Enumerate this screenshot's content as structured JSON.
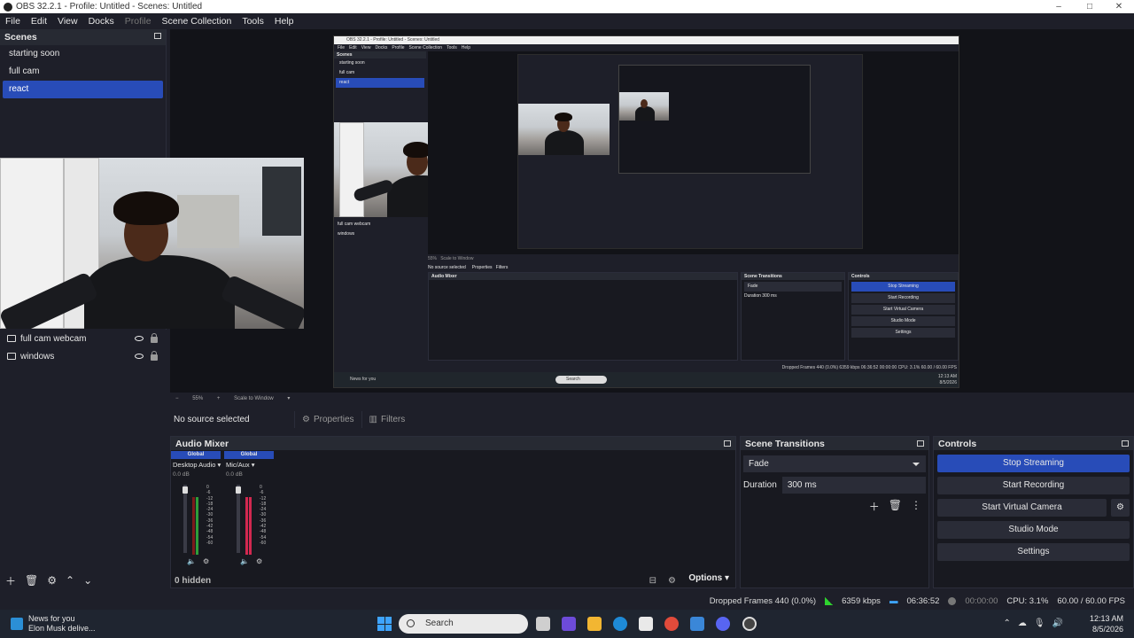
{
  "window": {
    "title": "OBS 32.2.1 - Profile: Untitled - Scenes: Untitled",
    "minimize": "–",
    "maximize": "□",
    "close": "✕"
  },
  "menu": [
    "File",
    "Edit",
    "View",
    "Docks",
    "Profile",
    "Scene Collection",
    "Tools",
    "Help"
  ],
  "scenes": {
    "header": "Scenes",
    "items": [
      "starting soon",
      "full cam",
      "react"
    ],
    "selected": "react"
  },
  "sources": {
    "items": [
      "full cam webcam",
      "windows"
    ]
  },
  "preview": {
    "nested_title": "OBS 32.2.1 - Profile: Untitled - Scenes: Untitled",
    "nested_menu": [
      "File",
      "Edit",
      "View",
      "Docks",
      "Profile",
      "Scene Collection",
      "Tools",
      "Help"
    ],
    "nested_scenes_header": "Scenes",
    "nested_scenes": [
      "starting soon",
      "full cam",
      "react"
    ],
    "nested_sources": [
      "full cam webcam",
      "windows"
    ],
    "nested_nosel": "No source selected",
    "nested_props": "Properties",
    "nested_filters": "Filters",
    "nested_mixer": "Audio Mixer",
    "nested_transitions": "Scene Transitions",
    "nested_controls": "Controls",
    "nested_fade": "Fade",
    "nested_duration": "Duration",
    "nested_dur_val": "300 ms",
    "nested_buttons": [
      "Stop Streaming",
      "Start Recording",
      "Start Virtual Camera",
      "Studio Mode",
      "Settings"
    ],
    "nested_status": "Dropped Frames 440 (0.0%)   6359 kbps   06:36:52   00:00:00   CPU: 3.1%   60.00 / 60.00 FPS",
    "nested_zoom": "55%",
    "nested_scale": "Scale to Window",
    "nested_news": "News for you",
    "nested_search": "Search",
    "nested_time": "12:13 AM",
    "nested_date": "8/5/2026"
  },
  "zoom": {
    "minus": "−",
    "value": "55%",
    "plus": "+",
    "scale": "Scale to Window"
  },
  "source_bar": {
    "no_selection": "No source selected",
    "properties": "Properties",
    "filters": "Filters"
  },
  "mixer": {
    "header": "Audio Mixer",
    "channels": [
      {
        "global": "Global",
        "name": "Desktop Audio",
        "db": "0.0 dB",
        "color": "#2e9e3a"
      },
      {
        "global": "Global",
        "name": "Mic/Aux",
        "db": "0.0 dB",
        "color": "#d22850"
      }
    ],
    "scale": [
      "0",
      "-6",
      "-12",
      "-18",
      "-24",
      "-30",
      "-36",
      "-42",
      "-48",
      "-54",
      "-60"
    ],
    "hidden": "0 hidden",
    "options": "Options"
  },
  "transitions": {
    "header": "Scene Transitions",
    "type": "Fade",
    "duration_label": "Duration",
    "duration_value": "300 ms"
  },
  "controls": {
    "header": "Controls",
    "buttons": [
      "Stop Streaming",
      "Start Recording",
      "Start Virtual Camera",
      "Studio Mode",
      "Settings"
    ]
  },
  "status": {
    "dropped": "Dropped Frames 440 (0.0%)",
    "bitrate": "6359 kbps",
    "stream_time": "06:36:52",
    "rec_time": "00:00:00",
    "cpu": "CPU: 3.1%",
    "fps": "60.00 / 60.00 FPS"
  },
  "taskbar": {
    "news_title": "News for you",
    "news_sub": "Elon Musk delive...",
    "search": "Search",
    "time": "12:13 AM",
    "date": "8/5/2026"
  },
  "colors": {
    "accent": "#284cb8",
    "bg": "#1e1f29",
    "panel": "#181920"
  }
}
